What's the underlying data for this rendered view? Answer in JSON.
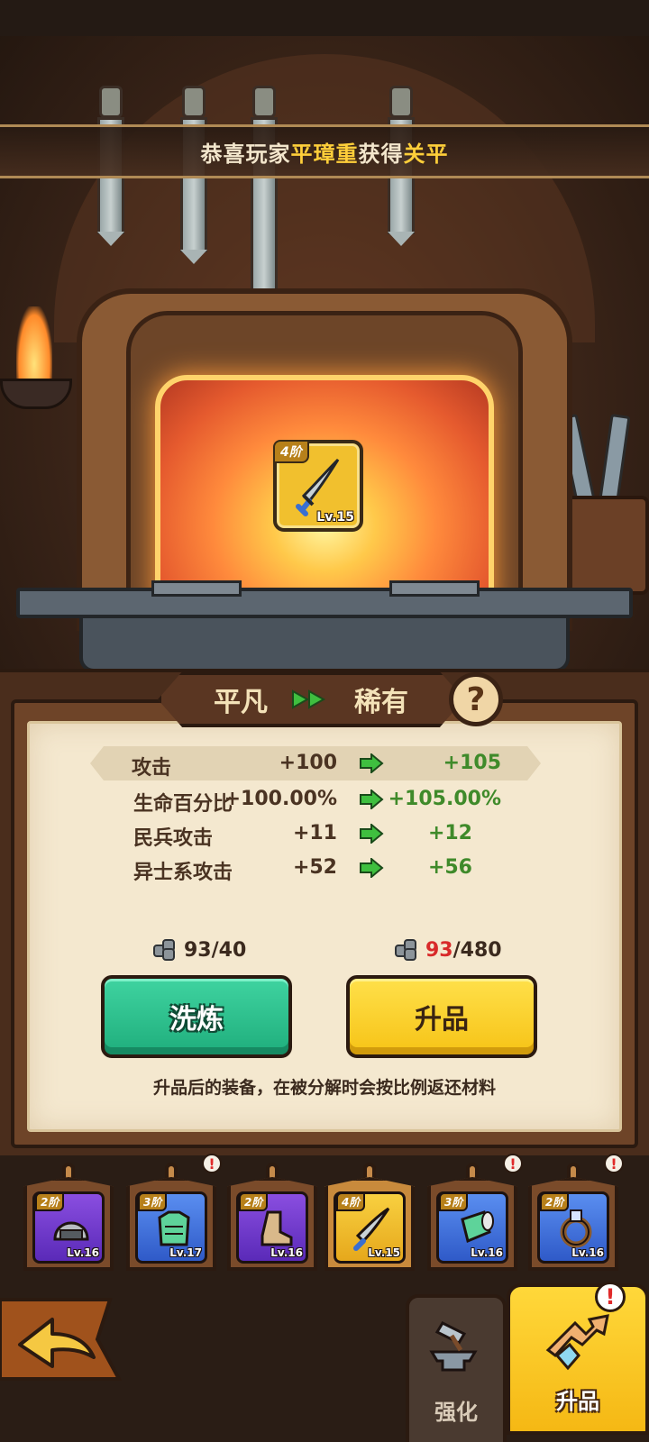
{
  "announcement": {
    "prefix": "恭喜玩家",
    "player": "平璋重",
    "middle": "获得",
    "reward": "关平"
  },
  "forge_item": {
    "tier": "4阶",
    "level": "Lv.15",
    "icon": "blade-icon"
  },
  "rarity": {
    "from": "平凡",
    "to": "稀有",
    "help": "?"
  },
  "stats": [
    {
      "name": "攻击",
      "current": "+100",
      "next": "+105"
    },
    {
      "name": "生命百分比",
      "current": "+100.00%",
      "next": "+105.00%"
    },
    {
      "name": "民兵攻击",
      "current": "+11",
      "next": "+12"
    },
    {
      "name": "异士系攻击",
      "current": "+52",
      "next": "+56"
    }
  ],
  "refine": {
    "cost": "93/40",
    "label": "洗炼"
  },
  "upgrade": {
    "cost_have": "93",
    "cost_need": "/480",
    "label": "升品"
  },
  "note": "升品后的装备，在被分解时会按比例返还材料",
  "equipment": [
    {
      "tier": "2阶",
      "level": "Lv.16",
      "icon": "helmet-icon",
      "rarity": "purple",
      "alert": false
    },
    {
      "tier": "3阶",
      "level": "Lv.17",
      "icon": "armor-icon",
      "rarity": "blue",
      "alert": true
    },
    {
      "tier": "2阶",
      "level": "Lv.16",
      "icon": "boots-icon",
      "rarity": "purple",
      "alert": false
    },
    {
      "tier": "4阶",
      "level": "Lv.15",
      "icon": "blade-icon",
      "rarity": "gold",
      "alert": false,
      "selected": true
    },
    {
      "tier": "3阶",
      "level": "Lv.16",
      "icon": "bracer-icon",
      "rarity": "blue",
      "alert": true
    },
    {
      "tier": "2阶",
      "level": "Lv.16",
      "icon": "ring-icon",
      "rarity": "blue",
      "alert": true
    }
  ],
  "alert_mark": "!",
  "tabs": {
    "strengthen": "强化",
    "upgrade": "升品"
  },
  "colors": {
    "accent_yellow": "#ffcf3a",
    "stat_green": "#3f8a2a",
    "warn_red": "#d82a2a",
    "refine_green": "#1fae7c"
  }
}
